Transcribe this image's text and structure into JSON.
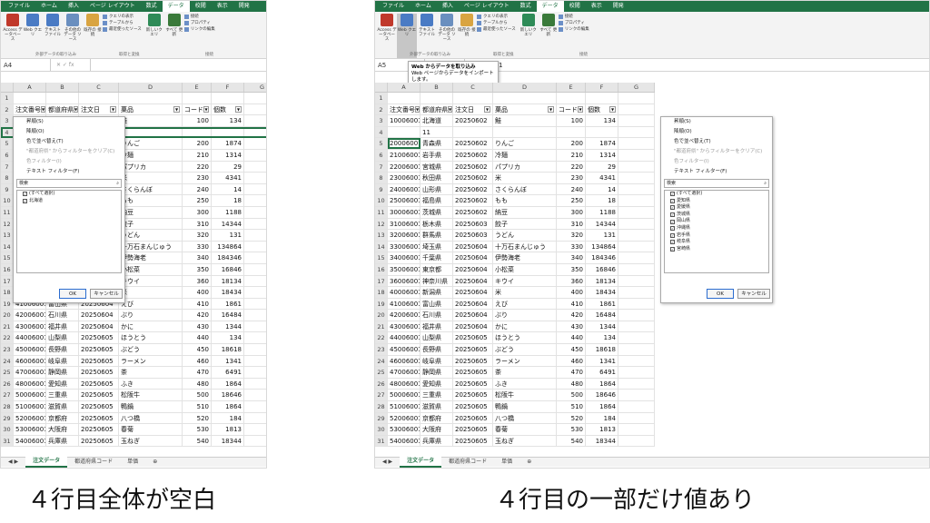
{
  "tabs": [
    "ファイル",
    "ホーム",
    "挿入",
    "ページ レイアウト",
    "数式",
    "データ",
    "校閲",
    "表示",
    "開発"
  ],
  "active_tab": "データ",
  "ribbon": {
    "buttons": [
      "Access データベース",
      "Web クエリ",
      "テキスト ファイル",
      "その他の データ ソース",
      "既存の 接続",
      "新しいク エリ",
      "すべて 更新"
    ],
    "small_items": [
      "クエリの表示",
      "テーブルから",
      "最近使ったソース"
    ],
    "conn_items": [
      "接続",
      "プロパティ",
      "リンクの編集"
    ],
    "groups": [
      "外部データの取り込み",
      "取得と変換",
      "接続"
    ]
  },
  "left": {
    "cell_ref": "A4",
    "filter_menu": {
      "items": [
        "昇順(S)",
        "降順(O)",
        "色で並べ替え(T)",
        "\"都道府県\" からフィルターをクリア(C)",
        "色フィルター(I)",
        "テキスト フィルター(F)"
      ],
      "search_placeholder": "検索",
      "list": [
        "(すべて選択)",
        "北海道"
      ],
      "ok": "OK",
      "cancel": "キャンセル"
    }
  },
  "right": {
    "cell_ref": "A5",
    "formula": "20006001",
    "tooltip_title": "Web からデータを取り込み",
    "tooltip_body": "Web ページからデータをインポートします。",
    "filter_menu": {
      "items": [
        "昇順(S)",
        "降順(O)",
        "色で並べ替え(T)",
        "\"都道府県\" からフィルターをクリア(C)",
        "色フィルター(I)",
        "テキスト フィルター(F)"
      ],
      "search_placeholder": "検索",
      "list": [
        "(すべて選択)",
        "愛知県",
        "愛媛県",
        "茨城県",
        "岡山県",
        "沖縄県",
        "岩手県",
        "岐阜県",
        "宮崎県"
      ],
      "ok": "OK",
      "cancel": "キャンセル"
    }
  },
  "columns": [
    "A",
    "B",
    "C",
    "D",
    "E",
    "F",
    "G"
  ],
  "headers": [
    "注文番号",
    "都道府県",
    "注文日",
    "菓品",
    "コード",
    "個数"
  ],
  "rows": [
    [
      "10006001",
      "北海道",
      "20250602",
      "鮭",
      "100",
      "134"
    ],
    [
      "",
      "",
      "",
      "",
      "",
      ""
    ],
    [
      "20006001",
      "青森県",
      "20250602",
      "りんご",
      "200",
      "1874"
    ],
    [
      "21006001",
      "岩手県",
      "20250602",
      "冷麺",
      "210",
      "1314"
    ],
    [
      "22006001",
      "宮城県",
      "20250602",
      "パプリカ",
      "220",
      "29"
    ],
    [
      "23006001",
      "秋田県",
      "20250602",
      "米",
      "230",
      "4341"
    ],
    [
      "24006001",
      "山形県",
      "20250602",
      "さくらんぼ",
      "240",
      "14"
    ],
    [
      "25006001",
      "福島県",
      "20250602",
      "もも",
      "250",
      "18"
    ],
    [
      "30006001",
      "茨城県",
      "20250602",
      "納豆",
      "300",
      "1188"
    ],
    [
      "31006001",
      "栃木県",
      "20250603",
      "餃子",
      "310",
      "14344"
    ],
    [
      "32006001",
      "群馬県",
      "20250603",
      "うどん",
      "320",
      "131"
    ],
    [
      "33006001",
      "埼玉県",
      "20250604",
      "十万石まんじゅう",
      "330",
      "134864"
    ],
    [
      "34006001",
      "千葉県",
      "20250604",
      "伊勢海老",
      "340",
      "184346"
    ],
    [
      "35006001",
      "東京都",
      "20250604",
      "小松菜",
      "350",
      "16846"
    ],
    [
      "36006001",
      "神奈川県",
      "20250604",
      "キウイ",
      "360",
      "18134"
    ],
    [
      "40006001",
      "新潟県",
      "20250604",
      "米",
      "400",
      "18434"
    ],
    [
      "41006001",
      "富山県",
      "20250604",
      "えび",
      "410",
      "1861"
    ],
    [
      "42006001",
      "石川県",
      "20250604",
      "ぶり",
      "420",
      "16484"
    ],
    [
      "43006001",
      "福井県",
      "20250604",
      "かに",
      "430",
      "1344"
    ],
    [
      "44006001",
      "山梨県",
      "20250605",
      "ほうとう",
      "440",
      "134"
    ],
    [
      "45006001",
      "長野県",
      "20250605",
      "ぶどう",
      "450",
      "18618"
    ],
    [
      "46006001",
      "岐阜県",
      "20250605",
      "ラーメン",
      "460",
      "1341"
    ],
    [
      "47006001",
      "静岡県",
      "20250605",
      "茶",
      "470",
      "6491"
    ],
    [
      "48006001",
      "愛知県",
      "20250605",
      "ふき",
      "480",
      "1864"
    ],
    [
      "50006001",
      "三重県",
      "20250605",
      "松阪牛",
      "500",
      "18646"
    ],
    [
      "51006001",
      "滋賀県",
      "20250605",
      "鴨鍋",
      "510",
      "1864"
    ],
    [
      "52006001",
      "京都府",
      "20250605",
      "八つ橋",
      "520",
      "184"
    ],
    [
      "53006001",
      "大阪府",
      "20250605",
      "春菊",
      "530",
      "1813"
    ],
    [
      "54006001",
      "兵庫県",
      "20250605",
      "玉ねぎ",
      "540",
      "18344"
    ]
  ],
  "right_row4": [
    "",
    "11",
    "",
    "",
    "",
    ""
  ],
  "sheet_tabs": [
    "注文データ",
    "都道府県コード",
    "単価"
  ],
  "captions": {
    "left": "４行目全体が空白",
    "right": "４行目の一部だけ値あり"
  }
}
